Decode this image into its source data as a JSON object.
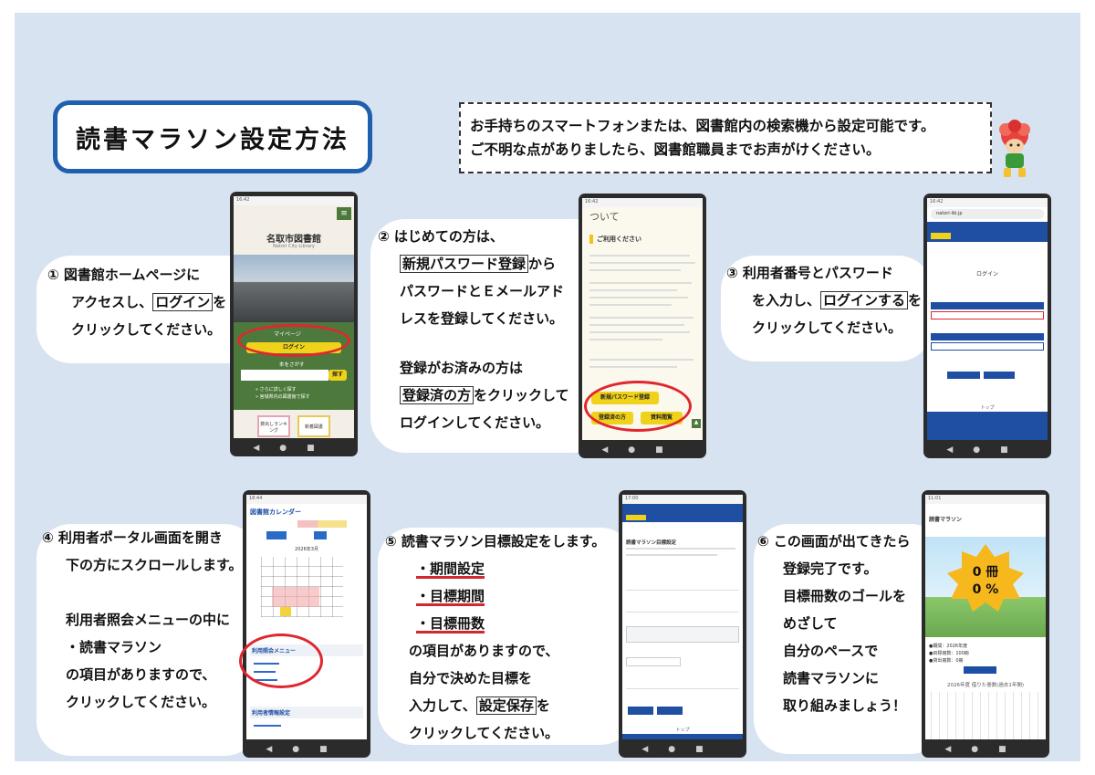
{
  "title": "読書マラソン設定方法",
  "notice": {
    "line1": "お手持ちのスマートフォンまたは、図書館内の検索機から設定可能です。",
    "line2": "ご不明な点がありましたら、図書館職員までお声がけください。"
  },
  "step1": {
    "line1": "① 図書館ホームページに",
    "line2a": "アクセスし、",
    "line2b": "ログイン",
    "line2c": "を",
    "line3": "クリックしてください。",
    "phone": {
      "library_name": "名取市図書館",
      "library_name_en": "Natori City Library",
      "mypage": "マイページ",
      "login": "ログイン",
      "search_label": "本をさがす",
      "search_button": "探す",
      "link1": "» さらに詳しく探す",
      "link2": "» 宮城県内の図書館で探す",
      "tile1": "貸出しランキング",
      "tile2": "新着図書"
    }
  },
  "step2": {
    "line1": "② はじめての方は、",
    "line2a": "新規パスワード登録",
    "line2b": "から",
    "line3": "パスワードとＥメールアド",
    "line4": "レスを登録してください。",
    "line5": "登録がお済みの方は",
    "line6a": "登録済の方",
    "line6b": "をクリックして",
    "line7": "ログインしてください。",
    "phone": {
      "header": "ついて",
      "section": "ご利用ください",
      "btn_new": "新規パスワード登録",
      "btn_registered": "登録済の方",
      "btn_fee": "資料閲覧"
    }
  },
  "step3": {
    "line1": "③ 利用者番号とパスワード",
    "line2a": "を入力し、",
    "line2b": "ログインする",
    "line2c": "を",
    "line3": "クリックしてください。",
    "phone": {
      "url": "natori-lib.jp",
      "heading": "ログイン",
      "footer": "トップ"
    }
  },
  "step4": {
    "line1": "④ 利用者ポータル画面を開き",
    "line2": "下の方にスクロールします。",
    "line3": "利用者照会メニューの中に",
    "line4": "・読書マラソン",
    "line5": "の項目がありますので、",
    "line6": "クリックしてください。",
    "phone": {
      "calendar_title": "図書館カレンダー",
      "month": "2026年3月",
      "menu_title": "利用照会メニュー",
      "settings_title": "利用者情報設定"
    }
  },
  "step5": {
    "line1": "⑤ 読書マラソン目標設定をします。",
    "item1": "・期間設定",
    "item2": "・目標期間",
    "item3": "・目標冊数",
    "line2": "の項目がありますので、",
    "line3": "自分で決めた目標を",
    "line4a": "入力して、",
    "line4b": "設定保存",
    "line4c": "を",
    "line5": "クリックしてください。",
    "phone": {
      "heading": "読書マラソン目標設定",
      "footer": "トップ"
    }
  },
  "step6": {
    "line1": "⑥ この画面が出てきたら",
    "line2": "登録完了です。",
    "line3": "目標冊数のゴールを",
    "line4": "めざして",
    "line5": "自分のペースで",
    "line6": "読書マラソンに",
    "line7": "取り組みましょう！",
    "phone": {
      "heading": "読書マラソン",
      "books": "0 冊",
      "percent": "0 %",
      "info1": "●期間：2026年度",
      "info2": "●目標冊数：100冊",
      "info3": "●貸出冊数：0冊",
      "chart_title": "2026年度 借りた冊数(過去1年間)"
    }
  },
  "colors": {
    "accent": "#1f5fae",
    "highlight_red": "#e0262e",
    "button_yellow": "#f0d21a",
    "library_green": "#4d7a3c"
  }
}
